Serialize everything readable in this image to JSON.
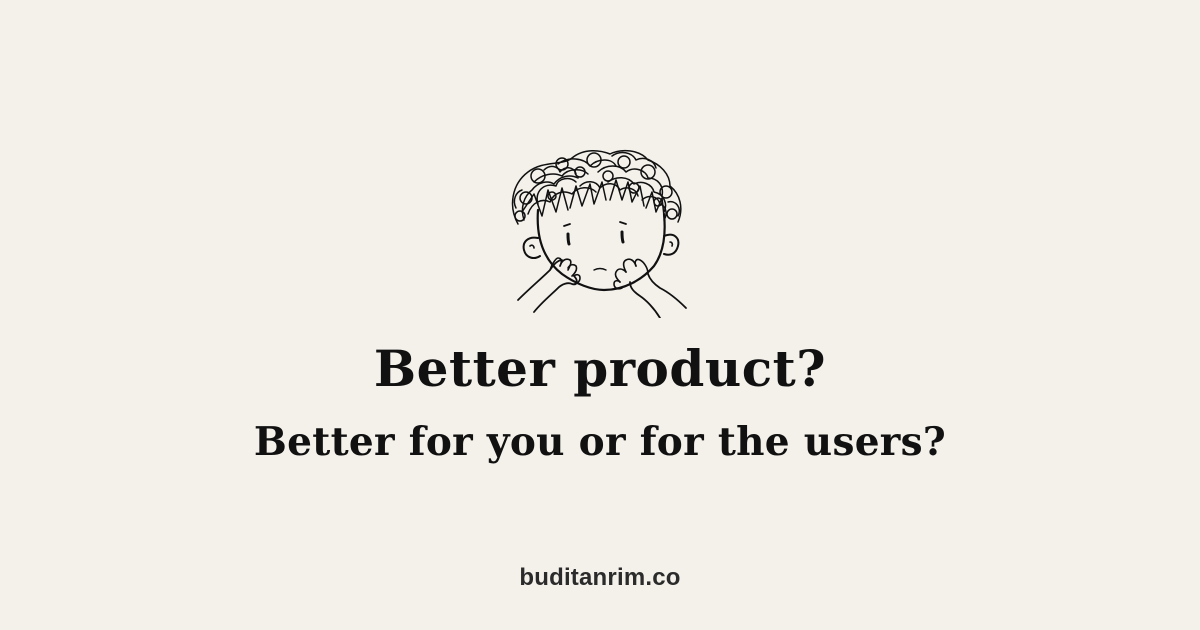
{
  "headline": "Better product?",
  "subheadline": "Better for you or for the users?",
  "site": "buditanrim.co",
  "illustration": "boy-covering-mouth-sketch",
  "colors": {
    "background": "#f4f1eb",
    "text": "#111111",
    "site_text": "#2b2b2b"
  }
}
